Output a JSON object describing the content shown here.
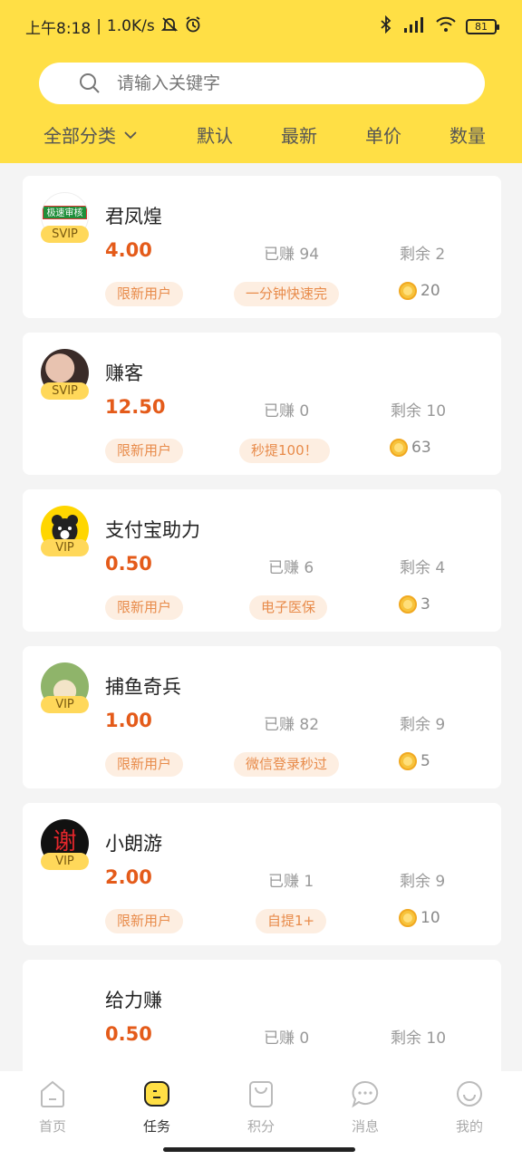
{
  "status": {
    "time": "上午8:18",
    "speed": "1.0K/s",
    "battery": "81"
  },
  "search": {
    "placeholder": "请输入关键字"
  },
  "filters": {
    "all": "全部分类",
    "default": "默认",
    "newest": "最新",
    "unit_price": "单价",
    "quantity": "数量"
  },
  "tasks": [
    {
      "name": "君凤煌",
      "badge": "SVIP",
      "price": "4.00",
      "earned": "已赚 94",
      "remain": "剩余 2",
      "tag1": "限新用户",
      "tag2": "一分钟快速完",
      "points": "20",
      "avatar_text": "极速审核"
    },
    {
      "name": "赚客",
      "badge": "SVIP",
      "price": "12.50",
      "earned": "已赚 0",
      "remain": "剩余 10",
      "tag1": "限新用户",
      "tag2": "秒提100！",
      "points": "63"
    },
    {
      "name": "支付宝助力",
      "badge": "VIP",
      "price": "0.50",
      "earned": "已赚 6",
      "remain": "剩余 4",
      "tag1": "限新用户",
      "tag2": "电子医保",
      "points": "3"
    },
    {
      "name": "捕鱼奇兵",
      "badge": "VIP",
      "price": "1.00",
      "earned": "已赚 82",
      "remain": "剩余 9",
      "tag1": "限新用户",
      "tag2": "微信登录秒过",
      "points": "5"
    },
    {
      "name": "小朗游",
      "badge": "VIP",
      "price": "2.00",
      "earned": "已赚 1",
      "remain": "剩余 9",
      "tag1": "限新用户",
      "tag2": "自提1+",
      "points": "10",
      "avatar_text": "谢"
    },
    {
      "name": "给力赚",
      "price": "0.50",
      "earned": "已赚 0",
      "remain": "剩余 10"
    }
  ],
  "tabs": {
    "home": "首页",
    "tasks": "任务",
    "points": "积分",
    "messages": "消息",
    "mine": "我的"
  },
  "colors": {
    "brand_yellow": "#ffdf45",
    "price_orange": "#e45b1a",
    "tag_bg": "#fdeee1",
    "tag_text": "#e88b4a"
  }
}
